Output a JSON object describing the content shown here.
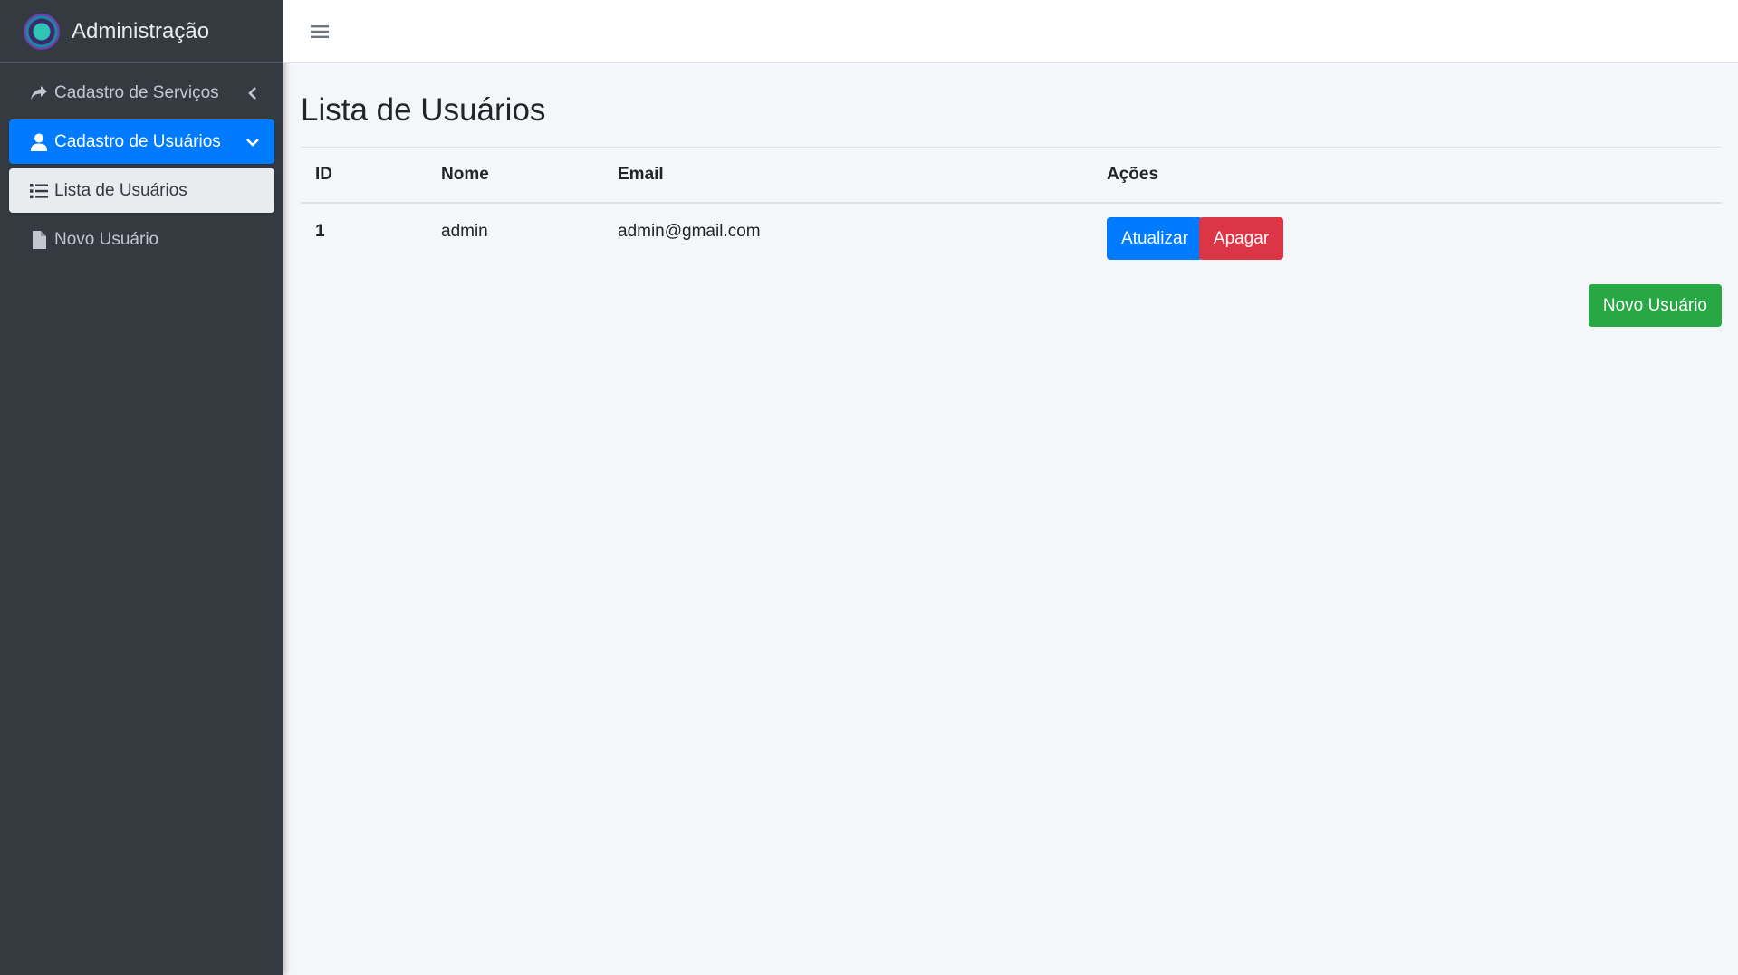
{
  "brand": {
    "title": "Administração",
    "logo_icon": "app-logo"
  },
  "sidebar": {
    "items": [
      {
        "label": "Cadastro de Serviços",
        "icon": "share-icon",
        "caret": "chevron-left-icon"
      },
      {
        "label": "Cadastro de Usuários",
        "icon": "user-icon",
        "caret": "chevron-down-icon",
        "active": true
      },
      {
        "label": "Lista de Usuários",
        "icon": "list-icon",
        "sub": true,
        "active": true
      },
      {
        "label": "Novo Usuário",
        "icon": "file-icon",
        "sub": true
      }
    ]
  },
  "header": {
    "menu_icon": "hamburger-icon"
  },
  "main": {
    "title": "Lista de Usuários",
    "table": {
      "headers": [
        "ID",
        "Nome",
        "Email",
        "Ações"
      ],
      "rows": [
        {
          "id": "1",
          "nome": "admin",
          "email": "admin@gmail.com",
          "update_label": "Atualizar",
          "delete_label": "Apagar"
        }
      ]
    },
    "new_user_label": "Novo Usuário"
  },
  "colors": {
    "primary": "#007bff",
    "danger": "#dc3545",
    "success": "#28a745",
    "sidebar": "#343a40"
  }
}
